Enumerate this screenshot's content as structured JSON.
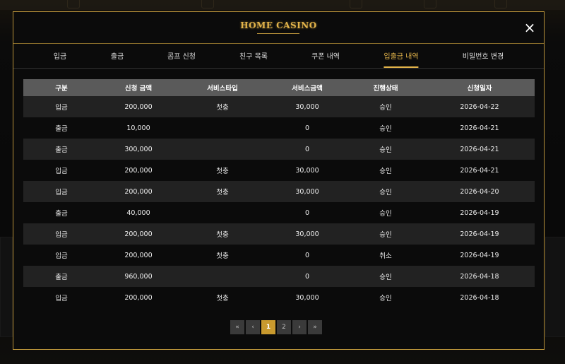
{
  "modal": {
    "logo_text": "HOME CASINO",
    "close_icon": "×",
    "tabs": [
      {
        "label": "입금"
      },
      {
        "label": "출금"
      },
      {
        "label": "콤프 신청"
      },
      {
        "label": "친구 목록"
      },
      {
        "label": "쿠폰 내역"
      },
      {
        "label": "입출금 내역",
        "active": true
      },
      {
        "label": "비밀번호 변경"
      }
    ],
    "table": {
      "headers": [
        "구분",
        "신청 금액",
        "서비스타입",
        "서비스금액",
        "진행상태",
        "신청일자"
      ],
      "rows": [
        [
          "입금",
          "200,000",
          "첫충",
          "30,000",
          "승인",
          "2026-04-22"
        ],
        [
          "출금",
          "10,000",
          "",
          "0",
          "승인",
          "2026-04-21"
        ],
        [
          "출금",
          "300,000",
          "",
          "0",
          "승인",
          "2026-04-21"
        ],
        [
          "입금",
          "200,000",
          "첫충",
          "30,000",
          "승인",
          "2026-04-21"
        ],
        [
          "입금",
          "200,000",
          "첫충",
          "30,000",
          "승인",
          "2026-04-20"
        ],
        [
          "출금",
          "40,000",
          "",
          "0",
          "승인",
          "2026-04-19"
        ],
        [
          "입금",
          "200,000",
          "첫충",
          "30,000",
          "승인",
          "2026-04-19"
        ],
        [
          "입금",
          "200,000",
          "첫충",
          "0",
          "취소",
          "2026-04-19"
        ],
        [
          "출금",
          "960,000",
          "",
          "0",
          "승인",
          "2026-04-18"
        ],
        [
          "입금",
          "200,000",
          "첫충",
          "30,000",
          "승인",
          "2026-04-18"
        ]
      ]
    },
    "pagination": {
      "first": "«",
      "prev": "‹",
      "pages": [
        "1",
        "2"
      ],
      "current": "1",
      "next": "›",
      "last": "»"
    }
  },
  "colors": {
    "accent_gold": "#e2b34a",
    "border_gold": "#b8923a",
    "header_bg": "#5a5a5a",
    "row_alt_bg": "#222222"
  }
}
